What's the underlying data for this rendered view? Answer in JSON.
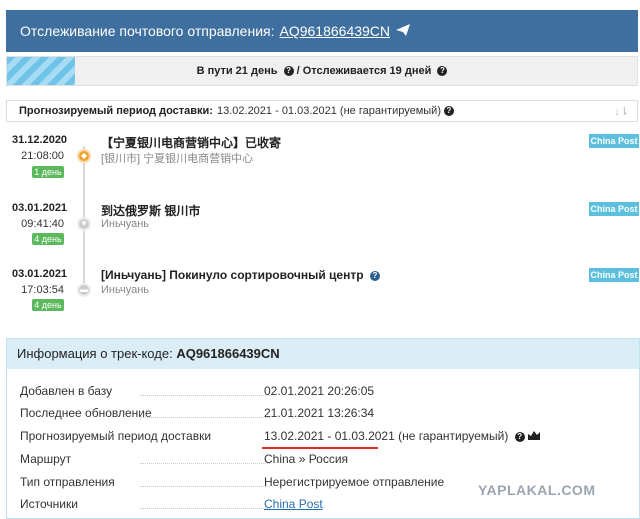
{
  "header": {
    "title": "Отслеживание почтового отправления:",
    "tracking_number": "AQ961866439CN",
    "send_icon": "paper-plane-icon"
  },
  "status": {
    "in_transit": "В пути 21 день",
    "tracked": "/ Отслеживается 19 дней"
  },
  "forecast": {
    "label": "Прогнозируемый период доставки:",
    "value": "13.02.2021 - 01.03.2021 (не гарантируемый)"
  },
  "events": [
    {
      "date": "31.12.2020",
      "time": "21:08:00",
      "days": "1 день",
      "title": "【宁夏银川电商营销中心】已收寄",
      "subtitle": "[银川市] 宁夏银川电商营销中心",
      "source": "China Post"
    },
    {
      "date": "03.01.2021",
      "time": "09:41:40",
      "days": "4 день",
      "title": "到达俄罗斯 银川市",
      "subtitle": "Иньчуань",
      "source": "China Post"
    },
    {
      "date": "03.01.2021",
      "time": "17:03:54",
      "days": "4 день",
      "title": "[Иньчуань] Покинуло сортировочный центр",
      "subtitle": "Иньчуань",
      "source": "China Post"
    }
  ],
  "info": {
    "heading": "Информация о трек-коде:",
    "code": "AQ961866439CN",
    "rows": [
      {
        "label": "Добавлен в базу",
        "value": "02.01.2021 20:26:05"
      },
      {
        "label": "Последнее обновление",
        "value": "21.01.2021 13:26:34"
      },
      {
        "label": "Прогнозируемый период доставки",
        "value": "13.02.2021 - 01.03.2021",
        "note": "(не гарантируемый)"
      },
      {
        "label": "Маршрут",
        "value": "China » Россия"
      },
      {
        "label": "Тип отправления",
        "value": "Нерегистрируемое отправление"
      },
      {
        "label": "Источники",
        "value": "China Post"
      }
    ]
  },
  "watermark": "YAPLAKAL.COM",
  "colors": {
    "header_bg": "#3e6f9e",
    "badge_bg": "#5bc0de",
    "days_bg": "#5cb85c",
    "underline": "#d9302a"
  }
}
